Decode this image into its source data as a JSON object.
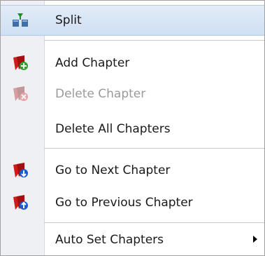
{
  "menu": {
    "items": [
      {
        "label": "Split",
        "icon": "split-icon",
        "highlighted": true
      },
      {
        "label": "Add Chapter",
        "icon": "add-chapter-icon"
      },
      {
        "label": "Delete Chapter",
        "icon": "delete-chapter-icon",
        "disabled": true
      },
      {
        "label": "Delete All Chapters"
      },
      {
        "label": "Go to Next Chapter",
        "icon": "next-chapter-icon"
      },
      {
        "label": "Go to Previous Chapter",
        "icon": "previous-chapter-icon"
      },
      {
        "label": "Auto Set Chapters",
        "submenu": true
      }
    ]
  },
  "colors": {
    "highlight": "#cfdff3",
    "bookmark_red": "#d11a1a",
    "badge_green": "#2ea52e",
    "badge_blue": "#1a5ad6",
    "disabled_text": "#9a9a9a"
  }
}
